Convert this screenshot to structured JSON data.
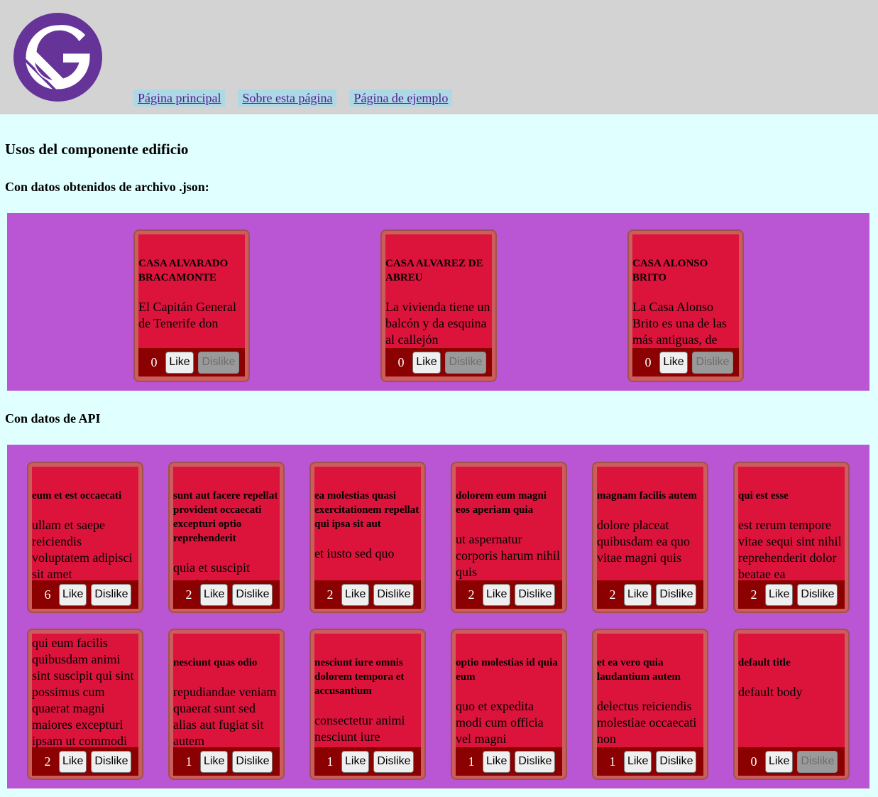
{
  "nav": {
    "home": "Página principal",
    "about": "Sobre esta página",
    "example": "Página de ejemplo"
  },
  "page_title": "Usos del componente edificio",
  "section_json": "Con datos obtenidos de archivo .json:",
  "section_api": "Con datos de API",
  "buttons": {
    "like": "Like",
    "dislike": "Dislike"
  },
  "json_cards": [
    {
      "title": "CASA ALVARADO BRACAMONTE",
      "body": "El Capitán General de Tenerife don",
      "likes": "0"
    },
    {
      "title": "CASA ALVAREZ DE ABREU",
      "body": "La vivienda tiene un balcón y da esquina al callejón",
      "likes": "0"
    },
    {
      "title": "CASA ALONSO BRITO",
      "body": "La Casa Alonso Brito es una de las más antiguas, de",
      "likes": "0"
    }
  ],
  "api_cards": [
    {
      "title": "eum et est occaecati",
      "body": "ullam et saepe reiciendis voluptatem adipisci sit amet",
      "likes": "6"
    },
    {
      "title": "sunt aut facere repellat provident occaecati excepturi optio reprehenderit",
      "body": "quia et suscipit suscipit",
      "likes": "2"
    },
    {
      "title": "ea molestias quasi exercitationem repellat qui ipsa sit aut",
      "body": "et iusto sed quo",
      "likes": "2"
    },
    {
      "title": "dolorem eum magni eos aperiam quia",
      "body": "ut aspernatur corporis harum nihil quis",
      "likes": "2"
    },
    {
      "title": "magnam facilis autem",
      "body": "dolore placeat quibusdam ea quo vitae magni quis",
      "likes": "2"
    },
    {
      "title": "qui est esse",
      "body": "est rerum tempore vitae sequi sint nihil reprehenderit dolor beatae ea",
      "likes": "2"
    },
    {
      "title": "",
      "body": "qui eum facilis quibusdam animi sint suscipit qui sint possimus cum quaerat magni maiores excepturi ipsam ut commodi",
      "likes": "2"
    },
    {
      "title": "nesciunt quas odio",
      "body": "repudiandae veniam quaerat sunt sed alias aut fugiat sit autem",
      "likes": "1"
    },
    {
      "title": "nesciunt iure omnis dolorem tempora et accusantium",
      "body": "consectetur animi nesciunt iure",
      "likes": "1"
    },
    {
      "title": "optio molestias id quia eum",
      "body": "quo et expedita modi cum officia vel magni",
      "likes": "1"
    },
    {
      "title": "et ea vero quia laudantium autem",
      "body": "delectus reiciendis molestiae occaecati non",
      "likes": "1"
    },
    {
      "title": "default title",
      "body": "default body",
      "likes": "0"
    }
  ],
  "colors": {
    "header_bg": "#d3d3d3",
    "page_bg": "#e0ffff",
    "panel_bg": "#ba55d3",
    "card_frame": "#cd5c5c",
    "card_bg": "#dc143c",
    "footer_bg": "#8b0000",
    "logo": "#663399"
  }
}
